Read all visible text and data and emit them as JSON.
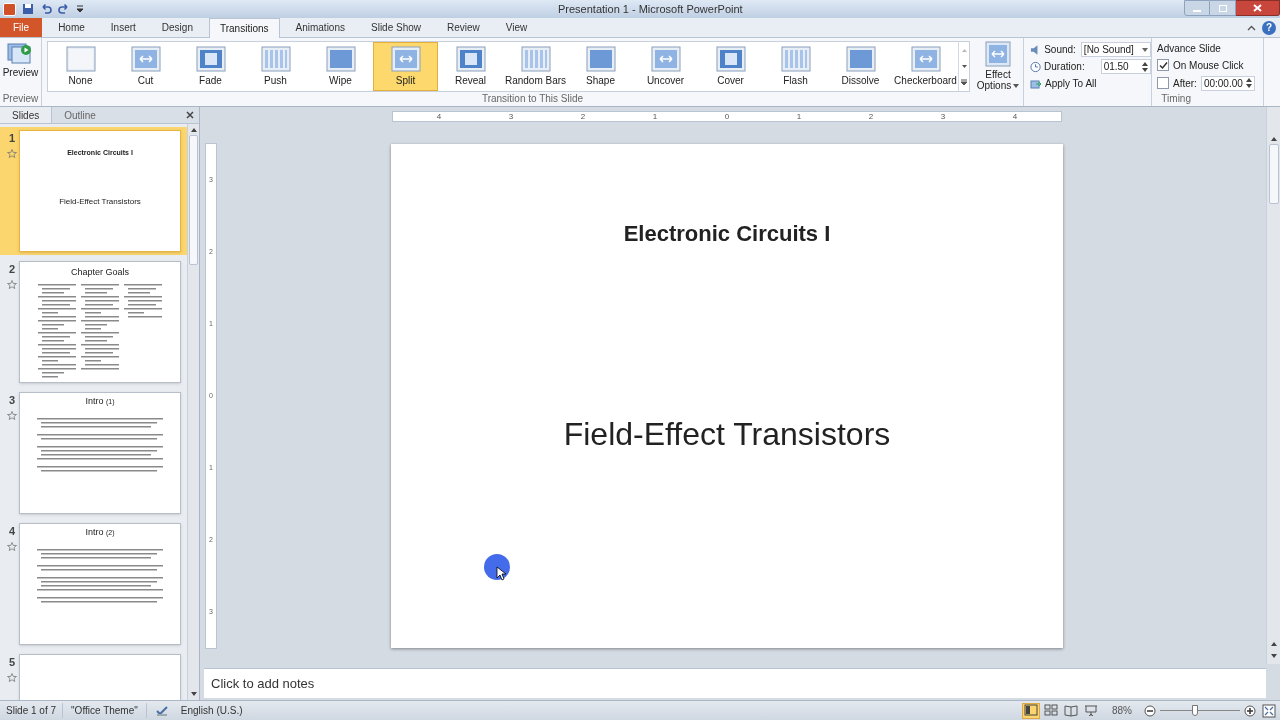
{
  "title_bar": {
    "title": "Presentation 1  -  Microsoft PowerPoint"
  },
  "tabs": [
    {
      "label": "File",
      "kind": "file",
      "selected": false
    },
    {
      "label": "Home",
      "kind": "tab",
      "selected": false
    },
    {
      "label": "Insert",
      "kind": "tab",
      "selected": false
    },
    {
      "label": "Design",
      "kind": "tab",
      "selected": false
    },
    {
      "label": "Transitions",
      "kind": "tab",
      "selected": true
    },
    {
      "label": "Animations",
      "kind": "tab",
      "selected": false
    },
    {
      "label": "Slide Show",
      "kind": "tab",
      "selected": false
    },
    {
      "label": "Review",
      "kind": "tab",
      "selected": false
    },
    {
      "label": "View",
      "kind": "tab",
      "selected": false
    }
  ],
  "help": "?",
  "ribbon": {
    "preview": {
      "button": "Preview",
      "group_label": "Preview"
    },
    "transitions": [
      {
        "label": "None",
        "selected": false
      },
      {
        "label": "Cut",
        "selected": false
      },
      {
        "label": "Fade",
        "selected": false
      },
      {
        "label": "Push",
        "selected": false
      },
      {
        "label": "Wipe",
        "selected": false
      },
      {
        "label": "Split",
        "selected": true
      },
      {
        "label": "Reveal",
        "selected": false
      },
      {
        "label": "Random Bars",
        "selected": false
      },
      {
        "label": "Shape",
        "selected": false
      },
      {
        "label": "Uncover",
        "selected": false
      },
      {
        "label": "Cover",
        "selected": false
      },
      {
        "label": "Flash",
        "selected": false
      },
      {
        "label": "Dissolve",
        "selected": false
      },
      {
        "label": "Checkerboard",
        "selected": false
      }
    ],
    "effect_options": [
      "Effect",
      "Options"
    ],
    "transitions_group_label": "Transition to This Slide",
    "timing": {
      "sound_label": "Sound:",
      "sound_value": "[No Sound]",
      "duration_label": "Duration:",
      "duration_value": "01.50",
      "apply_to_all": "Apply To All",
      "group_label": "Timing"
    },
    "advance": {
      "title": "Advance Slide",
      "on_mouse_click": {
        "label": "On Mouse Click",
        "checked": true
      },
      "after": {
        "label": "After:",
        "checked": false,
        "value": "00:00.00"
      }
    }
  },
  "slide_pane": {
    "tabs": [
      {
        "label": "Slides",
        "selected": true
      },
      {
        "label": "Outline",
        "selected": false
      }
    ],
    "slides": [
      {
        "number": "1",
        "kind": "title",
        "selected": true,
        "heading": "Electronic Circuits I",
        "subtitle": "Field-Effect Transistors"
      },
      {
        "number": "2",
        "kind": "columns",
        "selected": false,
        "heading": "Chapter Goals"
      },
      {
        "number": "3",
        "kind": "bullets",
        "selected": false,
        "heading": "Intro",
        "suffix": "(1)"
      },
      {
        "number": "4",
        "kind": "bullets",
        "selected": false,
        "heading": "Intro",
        "suffix": "(2)"
      },
      {
        "number": "5",
        "kind": "partial",
        "selected": false
      }
    ]
  },
  "rulers": {
    "horizontal": [
      "4",
      "3",
      "2",
      "1",
      "0",
      "1",
      "2",
      "3",
      "4"
    ],
    "vertical": [
      "3",
      "2",
      "1",
      "0",
      "1",
      "2",
      "3"
    ]
  },
  "slide": {
    "title": "Electronic Circuits I",
    "subtitle": "Field-Effect Transistors"
  },
  "notes": {
    "placeholder": "Click to add notes"
  },
  "status_bar": {
    "slide_info": "Slide 1 of 7",
    "theme": "\"Office Theme\"",
    "language": "English (U.S.)",
    "views": [
      {
        "kind": "normal",
        "selected": true
      },
      {
        "kind": "sorter",
        "selected": false
      },
      {
        "kind": "reading",
        "selected": false
      },
      {
        "kind": "show",
        "selected": false
      }
    ],
    "zoom": "88%",
    "zoom_slider": {
      "level": 0.44
    }
  }
}
